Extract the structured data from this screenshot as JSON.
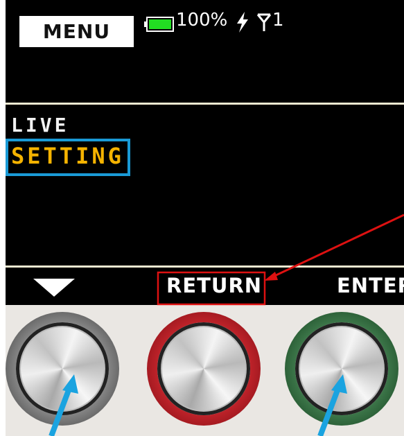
{
  "header": {
    "menu_label": "MENU",
    "battery": {
      "text": "100%",
      "color": "#22dd22"
    },
    "charge_icon": "lightning-icon",
    "antenna": {
      "icon": "antenna-icon",
      "text": "1"
    }
  },
  "menu": {
    "items": [
      {
        "label": "LIVE",
        "selected": false,
        "color": "#f2f2f2"
      },
      {
        "label": "SETTING",
        "selected": true,
        "color": "#f5b300"
      }
    ]
  },
  "softkeys": {
    "left": {
      "icon": "down-triangle-icon"
    },
    "center": {
      "label": "RETURN"
    },
    "right": {
      "label": "ENTER"
    }
  },
  "hardware_buttons": [
    {
      "name": "left-button",
      "ring_color": "#8a8a8a"
    },
    {
      "name": "center-button",
      "ring_color": "#c3242b"
    },
    {
      "name": "right-button",
      "ring_color": "#3f7a4c"
    }
  ],
  "annotations": {
    "highlight_box_color": "#1a9ad6",
    "callout_box_color": "#dd1111",
    "arrow_color": "#1aa3e0"
  }
}
